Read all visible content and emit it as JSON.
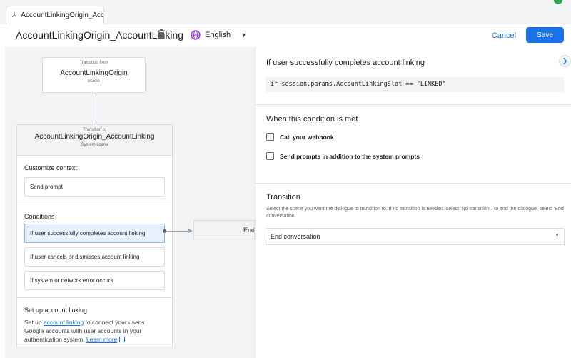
{
  "tab": {
    "title": "AccountLinkingOrigin_AccountLinking"
  },
  "header": {
    "title": "AccountLinkingOrigin_AccountLinking",
    "language": "English",
    "cancel_label": "Cancel",
    "save_label": "Save"
  },
  "flow": {
    "from_caption": "Transition from",
    "from_name": "AccountLinkingOrigin",
    "from_type": "Scene",
    "to_caption": "Transition to",
    "to_name": "AccountLinkingOrigin_AccountLinking",
    "to_type": "System scene",
    "customize_title": "Customize context",
    "send_prompt": "Send prompt",
    "conditions_title": "Conditions",
    "conditions": [
      "If user successfully completes account linking",
      "If user cancels or dismisses account linking",
      "If system or network error occurs"
    ],
    "setup_title": "Set up account linking",
    "setup_text_1": "Set up ",
    "setup_link": "account linking",
    "setup_text_2": " to connect your user's Google accounts with user accounts in your authentication system. ",
    "learn_more": "Learn more",
    "end_node": "End conversation"
  },
  "panel": {
    "condition_title": "If user successfully completes account linking",
    "condition_code": "if session.params.AccountLinkingSlot == \"LINKED\"",
    "when_title": "When this condition is met",
    "checkbox_webhook": "Call your webhook",
    "checkbox_prompts": "Send prompts in addition to the system prompts",
    "transition_title": "Transition",
    "transition_desc": "Select the scene you want the dialogue to transition to. If no transition is needed, select 'No transition'. To end the dialogue, select 'End conversation'.",
    "transition_value": "End conversation"
  },
  "colors": {
    "accent": "#1a73e8",
    "active_item": "#e8f0fe"
  }
}
